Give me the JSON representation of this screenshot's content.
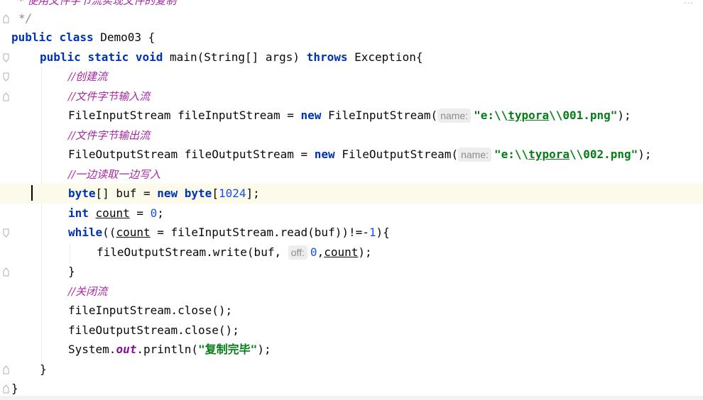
{
  "editor": {
    "lines": {
      "l0": "* 使用文件字节流实现文件的复制",
      "l1": "*/",
      "l2_kw1": "public",
      "l2_kw2": "class",
      "l2_rest": " Demo03 {",
      "l3_kw1": "public",
      "l3_kw2": "static",
      "l3_kw3": "void",
      "l3_mid": " main(String[] args) ",
      "l3_kw4": "throws",
      "l3_end": " Exception{",
      "l4": "//创建流",
      "l5": "//文件字节输入流",
      "l6_a": "FileInputStream fileInputStream = ",
      "l6_new": "new",
      "l6_b": " FileInputStream(",
      "l6_hint": "name:",
      "l6_str_a": "\"e:\\\\",
      "l6_str_ul": "typora",
      "l6_str_b": "\\\\001.png\"",
      "l6_end": ");",
      "l7": "//文件字节输出流",
      "l8_a": "FileOutputStream fileOutputStream = ",
      "l8_new": "new",
      "l8_b": " FileOutputStream(",
      "l8_hint": "name:",
      "l8_str_a": "\"e:\\\\",
      "l8_str_ul": "typora",
      "l8_str_b": "\\\\002.png\"",
      "l8_end": ");",
      "l9": "//一边读取一边写入",
      "l10_kw": "byte",
      "l10_a": "[] buf = ",
      "l10_new": "new",
      "l10_kw2": " byte",
      "l10_b": "[",
      "l10_num": "1024",
      "l10_end": "];",
      "l11_kw": "int",
      "l11_sp": " ",
      "l11_var": "count",
      "l11_a": " = ",
      "l11_num": "0",
      "l11_end": ";",
      "l12_kw": "while",
      "l12_a": "((",
      "l12_var": "count",
      "l12_b": " = fileInputStream.read(buf))!=-",
      "l12_num": "1",
      "l12_end": "){",
      "l13_a": "fileOutputStream.write(buf, ",
      "l13_hint": "off:",
      "l13_num": "0",
      "l13_b": ",",
      "l13_var": "count",
      "l13_end": ");",
      "l14": "}",
      "l15": "//关闭流",
      "l16": "fileInputStream.close();",
      "l17": "fileOutputStream.close();",
      "l18_a": "System.",
      "l18_static": "out",
      "l18_b": ".println(",
      "l18_str": "\"复制完毕\"",
      "l18_end": ");",
      "l19": "}",
      "l20": "}"
    },
    "more_indicator": "..."
  },
  "colors": {
    "keyword": "#0033b3",
    "string": "#067d17",
    "number": "#1750eb",
    "comment": "#a626a4",
    "current_line": "#fcfae8"
  }
}
